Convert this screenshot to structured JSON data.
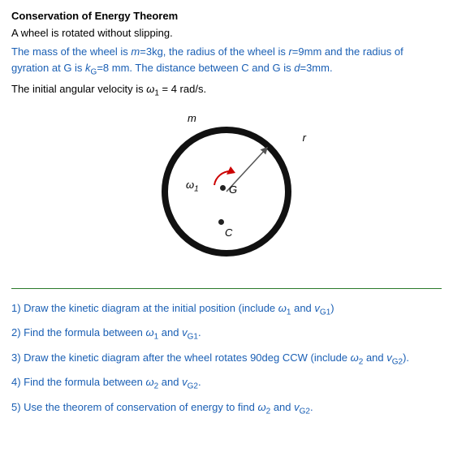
{
  "title": "Conservation of Energy Theorem",
  "subtitle": "A wheel is rotated without slipping.",
  "param_line": "The mass of the wheel is m=3kg, the radius of the wheel is r=9mm and the radius of gyration at G is k",
  "param_line2": "=8 mm. The distance between C and G is d=3mm.",
  "omega_line_pre": "The initial angular velocity is ",
  "omega_symbol": "ω₁",
  "omega_value": " = 4 rad/s.",
  "diagram": {
    "label_m": "m",
    "label_r": "r",
    "label_G": "G",
    "label_C": "C",
    "label_omega": "ω₁"
  },
  "questions": [
    "1) Draw the kinetic diagram at the initial position (include ω₁  and v",
    "2) Find the formula between ω₁ and v",
    "3) Draw the kinetic diagram after the wheel rotates 90deg CCW (include ω₂  and v",
    "4) Find the formula between ω₂  and v",
    "5) Use the theorem of conservation of energy to find ω₂   and v"
  ],
  "q_suffixes": [
    "G1).",
    "G1.",
    "G2).",
    "G2.",
    "G2."
  ],
  "and_text": "and"
}
